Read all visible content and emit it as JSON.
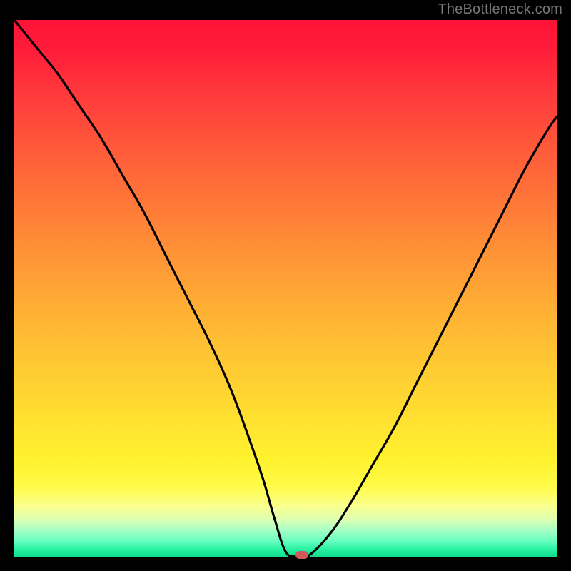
{
  "watermark": "TheBottleneck.com",
  "colors": {
    "curve": "#000000",
    "marker": "#cf5a5a",
    "frame": "#000000"
  },
  "chart_data": {
    "type": "line",
    "title": "",
    "xlabel": "",
    "ylabel": "",
    "xlim": [
      0,
      100
    ],
    "ylim": [
      0,
      100
    ],
    "grid": false,
    "legend": false,
    "annotations": [
      {
        "text": "TheBottleneck.com",
        "position": "top-right"
      }
    ],
    "series": [
      {
        "name": "bottleneck-curve",
        "x": [
          0,
          4,
          8,
          12,
          16,
          20,
          24,
          28,
          32,
          36,
          40,
          44,
          46,
          48,
          50,
          52,
          54,
          58,
          62,
          66,
          70,
          74,
          78,
          82,
          86,
          90,
          94,
          98,
          100
        ],
        "values": [
          100,
          95,
          90,
          84,
          78,
          71,
          64,
          56,
          48,
          40,
          31,
          20,
          14,
          7,
          1,
          0,
          0,
          4,
          10,
          17,
          24,
          32,
          40,
          48,
          56,
          64,
          72,
          79,
          82
        ]
      }
    ],
    "marker": {
      "x": 53,
      "y": 0
    }
  }
}
